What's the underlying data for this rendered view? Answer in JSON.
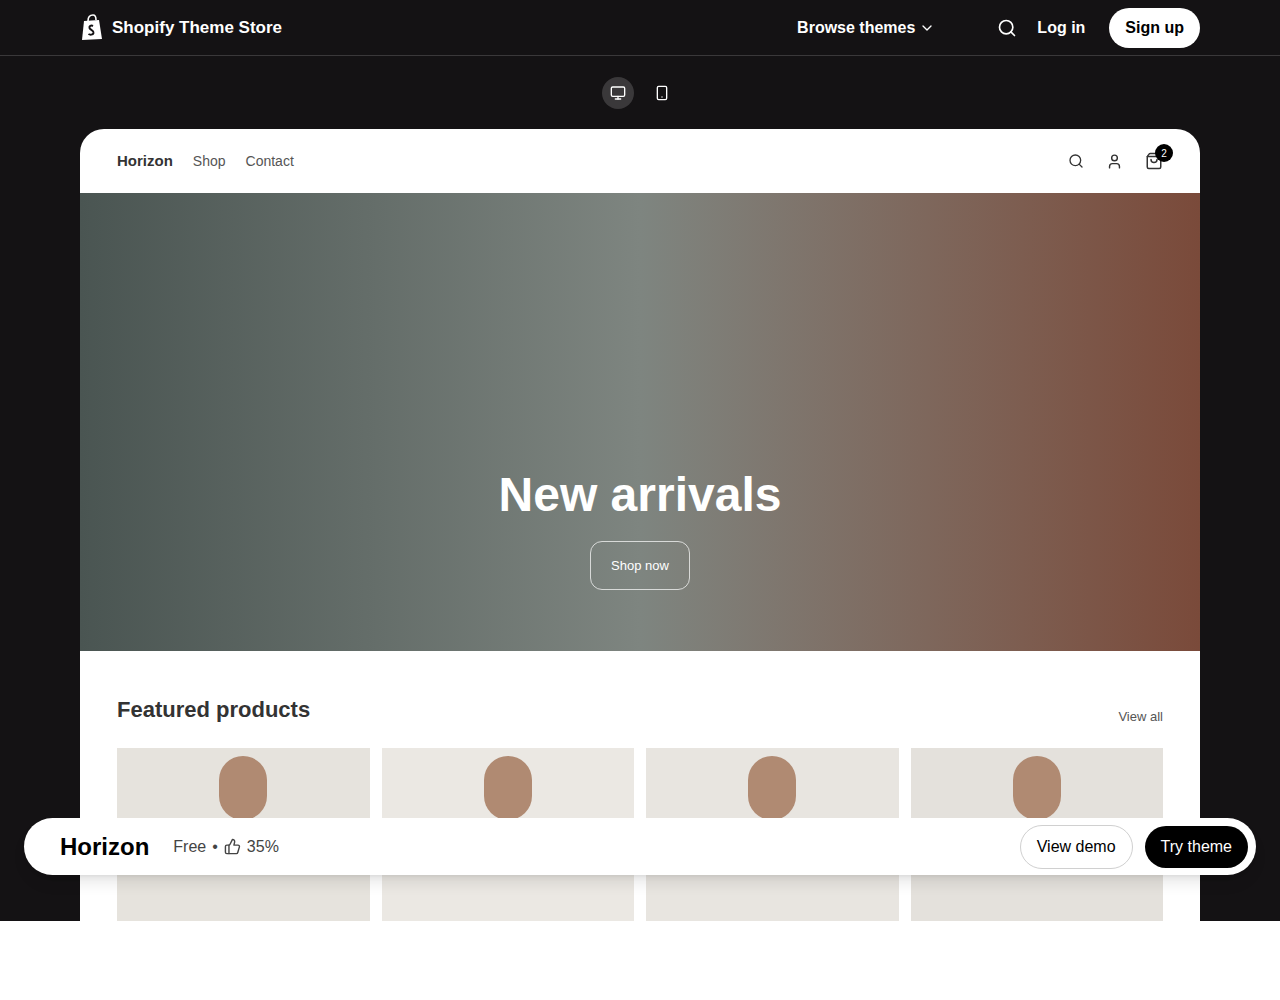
{
  "nav": {
    "brand": "Shopify Theme Store",
    "browse": "Browse themes",
    "login": "Log in",
    "signup": "Sign up"
  },
  "devices": [
    {
      "kind": "desktop",
      "selected": true
    },
    {
      "kind": "mobile",
      "selected": false
    }
  ],
  "preview": {
    "store_name": "Horizon",
    "menu": [
      "Shop",
      "Contact"
    ],
    "cart_count": "2",
    "hero": {
      "title": "New arrivals",
      "button": "Shop now"
    },
    "featured": {
      "title": "Featured products",
      "link": "View all",
      "products": [
        {
          "kind": "photo"
        },
        {
          "kind": "photo"
        },
        {
          "kind": "photo"
        },
        {
          "kind": "photo"
        }
      ]
    }
  },
  "bar": {
    "name": "Horizon",
    "price": "Free",
    "separator": "•",
    "rating": "35%",
    "buttons": [
      {
        "label": "View demo",
        "primary": false
      },
      {
        "label": "Try theme",
        "primary": true
      }
    ]
  }
}
